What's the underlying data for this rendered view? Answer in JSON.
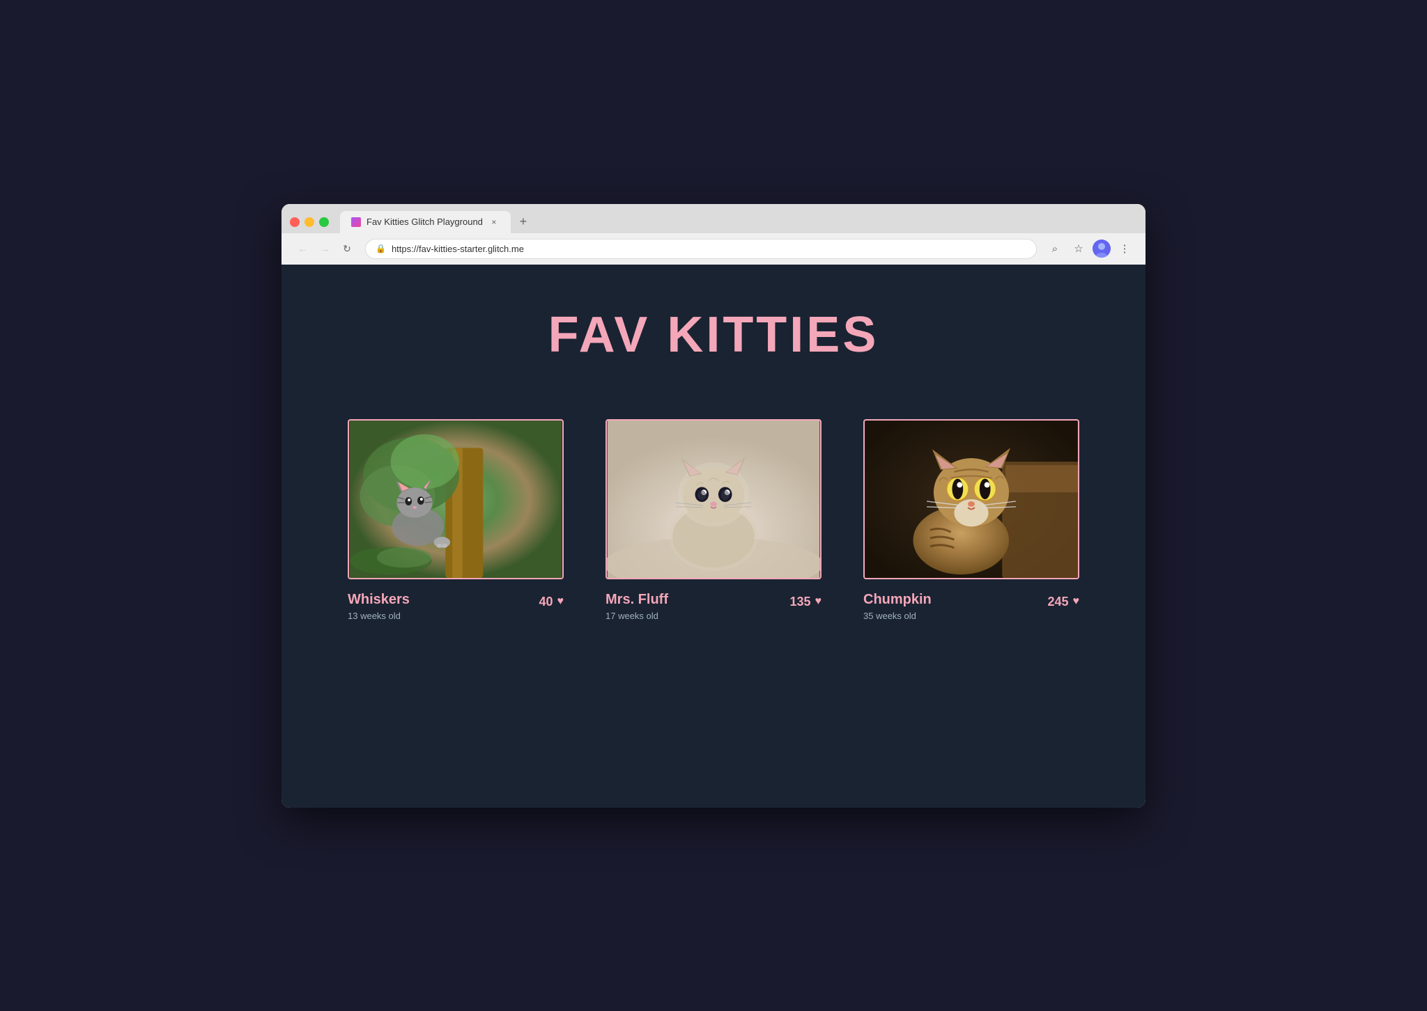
{
  "browser": {
    "tab_title": "Fav Kitties Glitch Playground",
    "tab_close_label": "×",
    "new_tab_label": "+",
    "url": "https://fav-kitties-starter.glitch.me",
    "nav": {
      "back_label": "←",
      "forward_label": "→",
      "refresh_label": "↻"
    },
    "toolbar": {
      "search_label": "⌕",
      "star_label": "☆",
      "menu_label": "⋮"
    }
  },
  "page": {
    "title": "FAV KITTIES",
    "cats": [
      {
        "name": "Whiskers",
        "age": "13 weeks old",
        "likes": "40",
        "image_desc": "gray kitten in tree"
      },
      {
        "name": "Mrs. Fluff",
        "age": "17 weeks old",
        "likes": "135",
        "image_desc": "fluffy kitten on white surface"
      },
      {
        "name": "Chumpkin",
        "age": "35 weeks old",
        "likes": "245",
        "image_desc": "tabby cat looking up"
      }
    ]
  },
  "colors": {
    "background": "#1a2332",
    "title_color": "#f4a7b9",
    "text_color": "#a0b0c0",
    "border_color": "#f4a7b9",
    "heart_color": "#f4a7b9"
  }
}
